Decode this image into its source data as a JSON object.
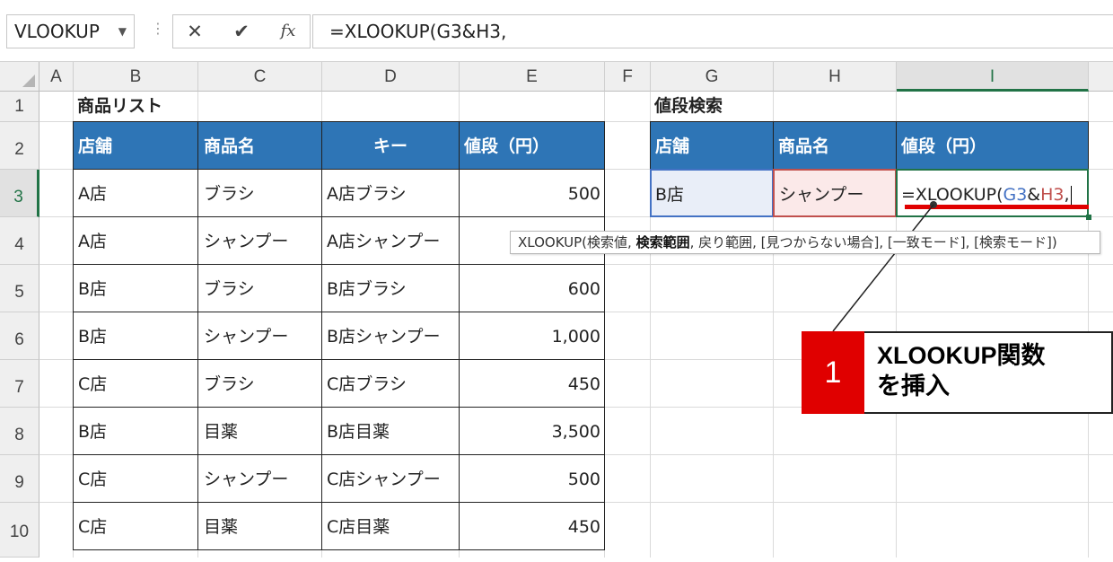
{
  "formula_bar": {
    "name_box": "VLOOKUP",
    "cancel_icon": "✕",
    "enter_icon": "✔",
    "fx_label": "fx",
    "formula": "=XLOOKUP(G3&H3,"
  },
  "columns": [
    "A",
    "B",
    "C",
    "D",
    "E",
    "F",
    "G",
    "H",
    "I"
  ],
  "selected_column": "I",
  "rows": [
    "1",
    "2",
    "3",
    "4",
    "5",
    "6",
    "7",
    "8",
    "9",
    "10"
  ],
  "selected_row": "3",
  "product_list": {
    "title": "商品リスト",
    "headers": [
      "店舗",
      "商品名",
      "キー",
      "値段（円）"
    ],
    "rows": [
      [
        "A店",
        "ブラシ",
        "A店ブラシ",
        "500"
      ],
      [
        "A店",
        "シャンプー",
        "A店シャンプー",
        ""
      ],
      [
        "B店",
        "ブラシ",
        "B店ブラシ",
        "600"
      ],
      [
        "B店",
        "シャンプー",
        "B店シャンプー",
        "1,000"
      ],
      [
        "C店",
        "ブラシ",
        "C店ブラシ",
        "450"
      ],
      [
        "B店",
        "目薬",
        "B店目薬",
        "3,500"
      ],
      [
        "C店",
        "シャンプー",
        "C店シャンプー",
        "500"
      ],
      [
        "C店",
        "目薬",
        "C店目薬",
        "450"
      ]
    ]
  },
  "price_search": {
    "title": "値段検索",
    "headers": [
      "店舗",
      "商品名",
      "値段（円）"
    ],
    "store": "B店",
    "product": "シャンプー",
    "formula_eq": "=XLOOKUP(",
    "ref1": "G3",
    "amp": "&",
    "ref2": "H3",
    "comma": ","
  },
  "tooltip": {
    "fn": "XLOOKUP(",
    "arg1": "検索値, ",
    "arg2_bold": "検索範囲",
    "rest": ", 戻り範囲, [見つからない場合], [一致モード], [検索モード])"
  },
  "callout": {
    "number": "1",
    "line1": "XLOOKUP関数",
    "line2": "を挿入"
  },
  "colors": {
    "header_blue": "#2e75b6",
    "ref_blue": "#4472c4",
    "ref_red": "#c0504d",
    "excel_green": "#217346",
    "callout_red": "#e00000"
  }
}
